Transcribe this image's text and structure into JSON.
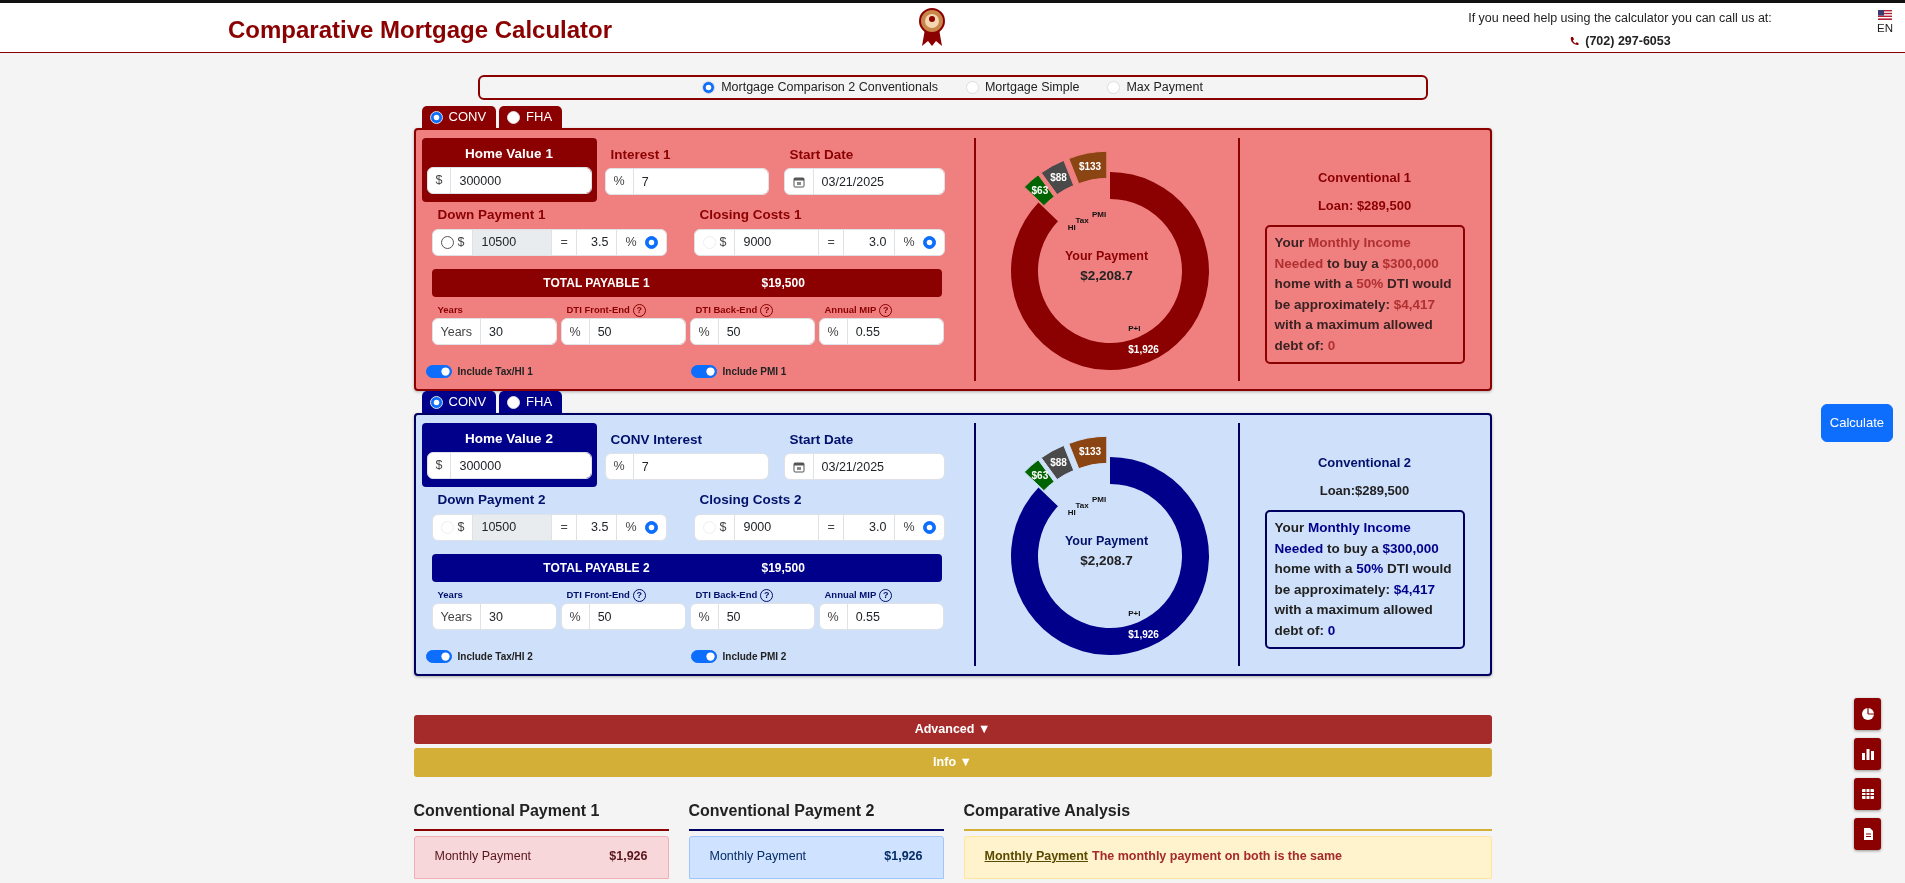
{
  "header": {
    "title": "Comparative Mortgage Calculator",
    "help_text": "If you need help using the calculator you can call us at:",
    "phone": "(702) 297-6053",
    "language": "EN"
  },
  "modes": [
    {
      "label": "Mortgage Comparison 2 Conventionals",
      "selected": true
    },
    {
      "label": "Mortgage Simple",
      "selected": false
    },
    {
      "label": "Max Payment",
      "selected": false
    }
  ],
  "panels": [
    {
      "loan_types": [
        {
          "label": "CONV",
          "selected": true
        },
        {
          "label": "FHA",
          "selected": false
        }
      ],
      "home_value": {
        "label": "Home Value 1",
        "prefix": "$",
        "value": "300000"
      },
      "interest": {
        "label": "Interest 1",
        "prefix": "%",
        "value": "7"
      },
      "start_date": {
        "label": "Start Date",
        "value": "03/21/2025"
      },
      "down_payment": {
        "label": "Down Payment 1",
        "currency": "$",
        "amount": "10500",
        "amount_readonly": true,
        "amount_option_disabled": false,
        "amount_selected": false,
        "equals": "=",
        "percent": "3.5",
        "percent_sign": "%",
        "percent_selected": true
      },
      "closing_costs": {
        "label": "Closing Costs 1",
        "currency": "$",
        "amount": "9000",
        "amount_readonly": false,
        "amount_option_disabled": true,
        "amount_selected": false,
        "equals": "=",
        "percent": "3.0",
        "percent_sign": "%",
        "percent_selected": true
      },
      "total": {
        "label": "TOTAL PAYABLE 1",
        "value": "$19,500"
      },
      "terms": [
        {
          "label": "Years",
          "prefix": "Years",
          "value": "30"
        },
        {
          "label": "DTI Front-End",
          "help": "?",
          "prefix": "%",
          "value": "50"
        },
        {
          "label": "DTI Back-End",
          "help": "?",
          "prefix": "%",
          "value": "50"
        },
        {
          "label": "Annual MIP",
          "help": "?",
          "prefix": "%",
          "value": "0.55"
        }
      ],
      "toggles": [
        {
          "label": "Include Tax/HI 1",
          "on": true
        },
        {
          "label": "Include PMI 1",
          "on": true
        }
      ],
      "chart_data": {
        "type": "donut",
        "categories": [
          "P+I",
          "HI",
          "Tax",
          "PMI"
        ],
        "values": [
          1926,
          63,
          88,
          133
        ],
        "value_labels": [
          "$1,926",
          "$63",
          "$88",
          "$133"
        ]
      },
      "payment_label": "Your Payment",
      "payment_value": "$2,208.7",
      "summary_title": "Conventional 1",
      "loan": "Loan: $289,500",
      "income_note": "Your **Monthly Income Needed** to buy a **$300,000** home with a **50%** DTI would be approximately: **$4,417** with a maximum allowed debt of: **0**"
    },
    {
      "loan_types": [
        {
          "label": "CONV",
          "selected": true
        },
        {
          "label": "FHA",
          "selected": false
        }
      ],
      "home_value": {
        "label": "Home Value 2",
        "prefix": "$",
        "value": "300000"
      },
      "interest": {
        "label": "CONV Interest",
        "prefix": "%",
        "value": "7"
      },
      "start_date": {
        "label": "Start Date",
        "value": "03/21/2025"
      },
      "down_payment": {
        "label": "Down Payment 2",
        "currency": "$",
        "amount": "10500",
        "amount_readonly": true,
        "amount_option_disabled": true,
        "amount_selected": false,
        "equals": "=",
        "percent": "3.5",
        "percent_sign": "%",
        "percent_selected": true
      },
      "closing_costs": {
        "label": "Closing Costs 2",
        "currency": "$",
        "amount": "9000",
        "amount_readonly": false,
        "amount_option_disabled": true,
        "amount_selected": false,
        "equals": "=",
        "percent": "3.0",
        "percent_sign": "%",
        "percent_selected": true
      },
      "total": {
        "label": "TOTAL PAYABLE 2",
        "value": "$19,500"
      },
      "terms": [
        {
          "label": "Years",
          "prefix": "Years",
          "value": "30"
        },
        {
          "label": "DTI Front-End",
          "help": "?",
          "prefix": "%",
          "value": "50"
        },
        {
          "label": "DTI Back-End",
          "help": "?",
          "prefix": "%",
          "value": "50"
        },
        {
          "label": "Annual MIP",
          "help": "?",
          "prefix": "%",
          "value": "0.55"
        }
      ],
      "toggles": [
        {
          "label": "Include Tax/HI 2",
          "on": true
        },
        {
          "label": "Include PMI 2",
          "on": true
        }
      ],
      "chart_data": {
        "type": "donut",
        "categories": [
          "P+I",
          "HI",
          "Tax",
          "PMI"
        ],
        "values": [
          1926,
          63,
          88,
          133
        ],
        "value_labels": [
          "$1,926",
          "$63",
          "$88",
          "$133"
        ]
      },
      "payment_label": "Your Payment",
      "payment_value": "$2,208.7",
      "summary_title": "Conventional 2",
      "loan": "Loan:$289,500",
      "income_note": "Your **Monthly Income Needed** to buy a **$300,000** home with a **50%** DTI would be approximately: **$4,417** with a maximum allowed debt of: **0**"
    }
  ],
  "calculate": "Calculate",
  "sections": [
    {
      "kind": "advanced",
      "label": "Advanced",
      "caret": "▼"
    },
    {
      "kind": "info",
      "label": "Info",
      "caret": "▼"
    }
  ],
  "results": [
    {
      "title": "Conventional Payment 1",
      "rows": [
        {
          "label": "Monthly Payment",
          "value": "$1,926"
        }
      ]
    },
    {
      "title": "Conventional Payment 2",
      "rows": [
        {
          "label": "Monthly Payment",
          "value": "$1,926"
        }
      ]
    }
  ],
  "analysis": {
    "title": "Comparative Analysis",
    "items": [
      {
        "label": "Monthly Payment",
        "text": "The monthly payment on both is the same"
      }
    ]
  }
}
